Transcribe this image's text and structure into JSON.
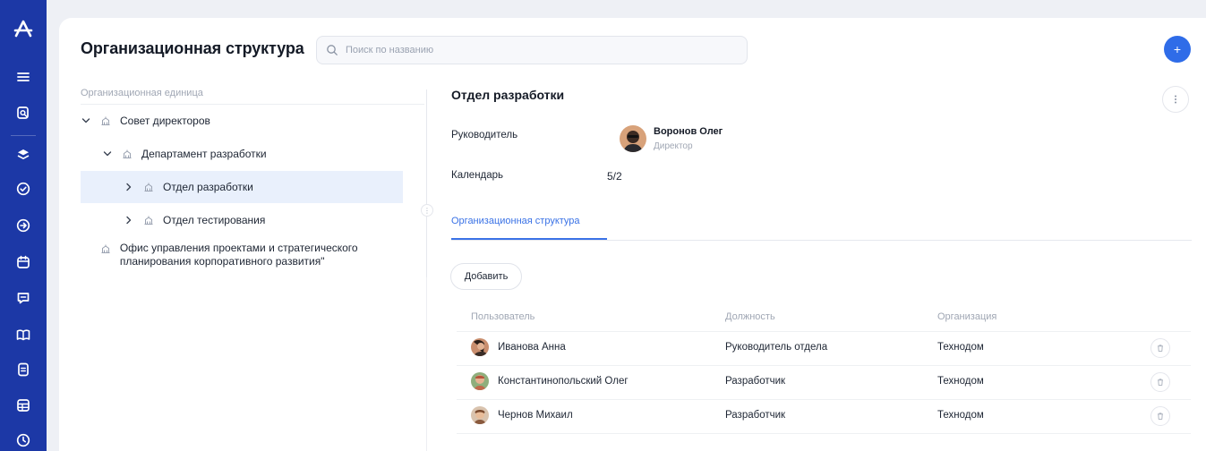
{
  "header": {
    "title": "Организационная структура",
    "search_placeholder": "Поиск по названию",
    "add_label": "+"
  },
  "tree": {
    "column_header": "Организационная единица",
    "items": [
      {
        "label": "Совет директоров",
        "expanded": true,
        "level": 0
      },
      {
        "label": "Департамент разработки",
        "expanded": true,
        "level": 1
      },
      {
        "label": "Отдел разработки",
        "expanded": false,
        "level": 2,
        "selected": true
      },
      {
        "label": "Отдел тестирования",
        "expanded": false,
        "level": 2
      },
      {
        "label": "Офис управления проектами и стратегического планирования корпоративного развития\"",
        "level": 0
      }
    ]
  },
  "details": {
    "title": "Отдел разработки",
    "manager_label": "Руководитель",
    "manager_name": "Воронов Олег",
    "manager_role": "Директор",
    "calendar_label": "Календарь",
    "calendar_value": "5/2",
    "tabs": [
      {
        "label": "Организационная структура",
        "active": true
      }
    ],
    "add_button": "Добавить",
    "table": {
      "columns": [
        "Пользователь",
        "Должность",
        "Организация"
      ],
      "rows": [
        {
          "user": "Иванова Анна",
          "position": "Руководитель отдела",
          "organization": "Технодом"
        },
        {
          "user": "Константинопольский Олег",
          "position": "Разработчик",
          "organization": "Технодом"
        },
        {
          "user": "Чернов Михаил",
          "position": "Разработчик",
          "organization": "Технодом"
        }
      ]
    }
  },
  "colors": {
    "rail": "#1c38a6",
    "accent": "#2f6ce8",
    "selected_row": "#e9f0fc"
  },
  "icons": {
    "rail": [
      "logo-icon",
      "menu-icon",
      "search-doc-icon",
      "layers-icon",
      "check-circle-icon",
      "arrow-circle-icon",
      "calendar-icon",
      "chat-icon",
      "book-icon",
      "document-icon",
      "table-icon",
      "clock-icon"
    ]
  }
}
